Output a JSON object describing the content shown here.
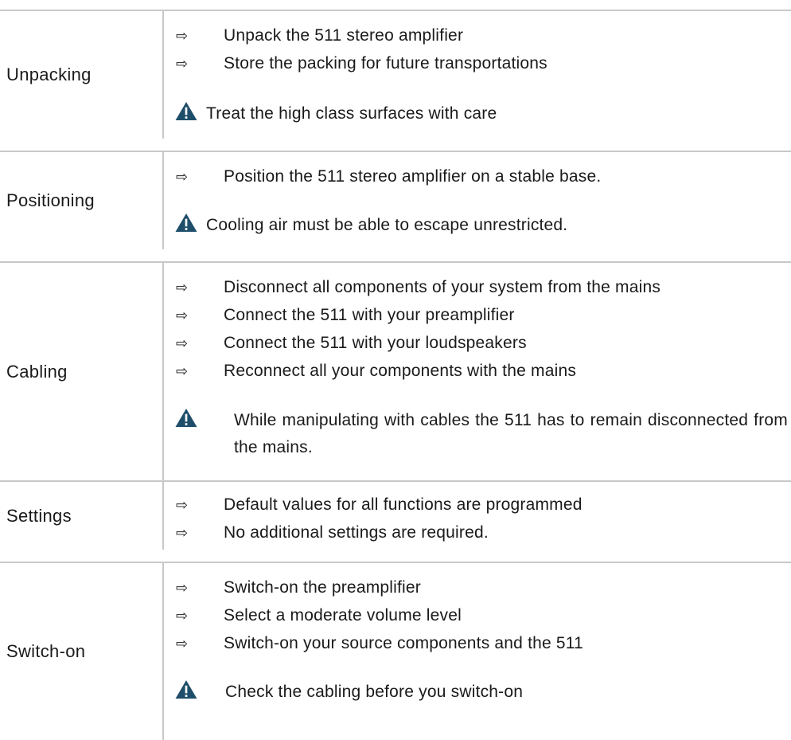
{
  "sections": [
    {
      "label": "Unpacking",
      "steps": [
        "Unpack the 511 stereo amplifier",
        "Store the packing for future transportations"
      ],
      "warning": "Treat the high class surfaces with care"
    },
    {
      "label": "Positioning",
      "steps": [
        "Position the 511 stereo amplifier on a stable base."
      ],
      "warning": "Cooling air must be able to escape unrestricted."
    },
    {
      "label": "Cabling",
      "steps": [
        "Disconnect all components of your system from the mains",
        "Connect the 511 with your preamplifier",
        "Connect the 511 with your loudspeakers",
        "Reconnect all your components with the mains"
      ],
      "warning": "While manipulating with cables the 511 has to remain disconnected from the mains."
    },
    {
      "label": "Settings",
      "steps": [
        "Default values for all functions are programmed",
        "No additional settings are required."
      ]
    },
    {
      "label": "Switch-on",
      "steps": [
        "Switch-on the preamplifier",
        "Select a moderate volume level",
        "Switch-on your source components and the 511"
      ],
      "warning": "Check the cabling before you switch-on"
    }
  ],
  "icons": {
    "step_arrow": "arrow-right-icon",
    "warning": "warning-triangle-icon"
  },
  "colors": {
    "warning_icon": "#1f4e6b",
    "rule": "#c8c8c8",
    "text": "#1a1a1a"
  }
}
